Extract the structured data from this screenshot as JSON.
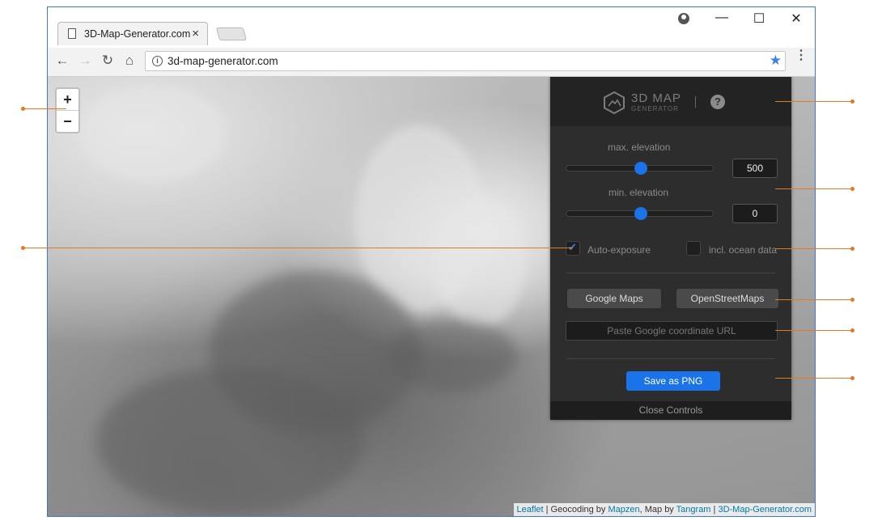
{
  "browser": {
    "tab_title": "3D-Map-Generator.com",
    "tab_close": "×",
    "url": "3d-map-generator.com",
    "window_controls": {
      "minimize": "—",
      "maximize": "☐",
      "close": "✕"
    },
    "nav": {
      "back": "←",
      "forward": "→",
      "reload": "↻",
      "home": "⌂"
    },
    "star": "★",
    "menu": "⋮"
  },
  "map": {
    "zoom_in": "+",
    "zoom_out": "−",
    "attribution": {
      "leaflet": "Leaflet",
      "sep1": " | Geocoding by ",
      "mapzen": "Mapzen",
      "sep2": ", Map by ",
      "tangram": "Tangram",
      "sep3": " | ",
      "site": "3D-Map-Generator.com"
    }
  },
  "panel": {
    "logo_main": "3D MAP",
    "logo_sub": "GENERATOR",
    "help": "?",
    "max_label": "max. elevation",
    "max_value": "500",
    "max_slider_fraction": 0.5,
    "min_label": "min. elevation",
    "min_value": "0",
    "min_slider_fraction": 0.5,
    "auto_exposure_label": "Auto-exposure",
    "auto_exposure_checked": true,
    "ocean_label": "incl. ocean data",
    "ocean_checked": false,
    "google_maps": "Google Maps",
    "osm": "OpenStreetMaps",
    "url_placeholder": "Paste Google coordinate URL",
    "save_png": "Save as PNG",
    "close_controls": "Close Controls"
  },
  "colors": {
    "accent": "#1a73e8",
    "callout": "#e87722",
    "panel_bg": "#2d2d2d"
  }
}
